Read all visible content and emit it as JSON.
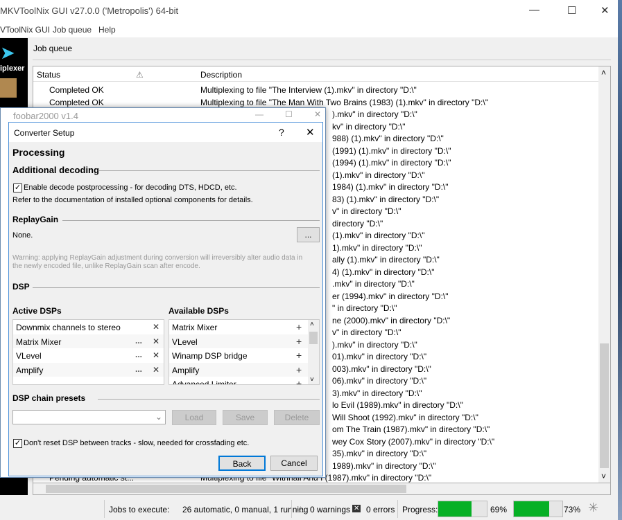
{
  "mkv": {
    "title": "MKVToolNix GUI v27.0.0 ('Metropolis') 64-bit",
    "menu": [
      "VToolNix GUI",
      "Job queue",
      "Help"
    ],
    "sidebar_label": "iplexer",
    "page_title": "Job queue",
    "columns": [
      "Status",
      "Description"
    ],
    "rows": [
      {
        "status": "Completed OK",
        "desc": "Multiplexing to file \"The Interview (1).mkv\" in directory \"D:\\\"",
        "frag": ""
      },
      {
        "status": "Completed OK",
        "desc": "Multiplexing to file \"The Man With Two Brains (1983) (1).mkv\" in directory \"D:\\\"",
        "frag": ""
      },
      {
        "status": "",
        "desc": "",
        "frag": ").mkv\" in directory \"D:\\\""
      },
      {
        "status": "",
        "desc": "",
        "frag": "kv\" in directory \"D:\\\""
      },
      {
        "status": "",
        "desc": "",
        "frag": "988) (1).mkv\" in directory \"D:\\\""
      },
      {
        "status": "",
        "desc": "",
        "frag": "(1991) (1).mkv\" in directory \"D:\\\""
      },
      {
        "status": "",
        "desc": "",
        "frag": "(1994) (1).mkv\" in directory \"D:\\\""
      },
      {
        "status": "",
        "desc": "",
        "frag": "(1).mkv\" in directory \"D:\\\""
      },
      {
        "status": "",
        "desc": "",
        "frag": "1984) (1).mkv\" in directory \"D:\\\""
      },
      {
        "status": "",
        "desc": "",
        "frag": "83) (1).mkv\" in directory \"D:\\\""
      },
      {
        "status": "",
        "desc": "",
        "frag": "v\" in directory \"D:\\\""
      },
      {
        "status": "",
        "desc": "",
        "frag": "directory \"D:\\\""
      },
      {
        "status": "",
        "desc": "",
        "frag": "(1).mkv\" in directory \"D:\\\""
      },
      {
        "status": "",
        "desc": "",
        "frag": "1).mkv\" in directory \"D:\\\""
      },
      {
        "status": "",
        "desc": "",
        "frag": "ally (1).mkv\" in directory \"D:\\\""
      },
      {
        "status": "",
        "desc": "",
        "frag": "4) (1).mkv\" in directory \"D:\\\""
      },
      {
        "status": "",
        "desc": "",
        "frag": ".mkv\" in directory \"D:\\\""
      },
      {
        "status": "",
        "desc": "",
        "frag": "er (1994).mkv\" in directory \"D:\\\""
      },
      {
        "status": "",
        "desc": "",
        "frag": "\" in directory \"D:\\\""
      },
      {
        "status": "",
        "desc": "",
        "frag": "ne (2000).mkv\" in directory \"D:\\\""
      },
      {
        "status": "",
        "desc": "",
        "frag": "v\" in directory \"D:\\\""
      },
      {
        "status": "",
        "desc": "",
        "frag": ").mkv\" in directory \"D:\\\""
      },
      {
        "status": "",
        "desc": "",
        "frag": "01).mkv\" in directory \"D:\\\""
      },
      {
        "status": "",
        "desc": "",
        "frag": "003).mkv\" in directory \"D:\\\""
      },
      {
        "status": "",
        "desc": "",
        "frag": "06).mkv\" in directory \"D:\\\""
      },
      {
        "status": "",
        "desc": "",
        "frag": "3).mkv\" in directory \"D:\\\""
      },
      {
        "status": "",
        "desc": "",
        "frag": "lo Evil (1989).mkv\" in directory \"D:\\\""
      },
      {
        "status": "",
        "desc": "",
        "frag": "Will Shoot (1992).mkv\" in directory \"D:\\\""
      },
      {
        "status": "",
        "desc": "",
        "frag": "om The Train (1987).mkv\" in directory \"D:\\\""
      },
      {
        "status": "",
        "desc": "",
        "frag": "wey Cox Story (2007).mkv\" in directory \"D:\\\""
      },
      {
        "status": "",
        "desc": "",
        "frag": "35).mkv\" in directory \"D:\\\""
      },
      {
        "status": "",
        "desc": "",
        "frag": "1989).mkv\" in directory \"D:\\\""
      },
      {
        "status": "Pending automatic st...",
        "desc": "Multiplexing to file \"Withnail And I (1987).mkv\" in directory \"D:\\\"",
        "frag": ""
      }
    ],
    "status": {
      "jobs_label": "Jobs to execute:",
      "jobs": "26 automatic, 0 manual, 1 running",
      "warnings": "0 warnings",
      "errors": "0 errors",
      "progress_label": "Progress:",
      "progress1": 69,
      "progress1_text": "69%",
      "progress2": 73,
      "progress2_text": "73%"
    }
  },
  "foobar": {
    "title": "foobar2000 v1.4",
    "dialog": {
      "title": "Converter Setup",
      "help": "?",
      "close": "✕",
      "heading": "Processing",
      "additional_decoding": "Additional decoding",
      "decode_check": "Enable decode postprocessing - for decoding DTS, HDCD, etc.",
      "decode_checked": true,
      "decode_note": "Refer to the documentation of installed optional components for details.",
      "replaygain": "ReplayGain",
      "replaygain_value": "None.",
      "more": "...",
      "warning1": "Warning: applying ReplayGain adjustment during conversion will irreversibly alter audio data in",
      "warning2": "the newly encoded file, unlike ReplayGain scan after encode.",
      "dsp": "DSP",
      "active_label": "Active DSPs",
      "available_label": "Available DSPs",
      "active": [
        {
          "name": "Downmix channels to stereo",
          "cfg": ""
        },
        {
          "name": "Matrix Mixer",
          "cfg": "..."
        },
        {
          "name": "VLevel",
          "cfg": "..."
        },
        {
          "name": "Amplify",
          "cfg": "..."
        }
      ],
      "available": [
        "Matrix Mixer",
        "VLevel",
        "Winamp DSP bridge",
        "Amplify",
        "Advanced Limiter"
      ],
      "presets": "DSP chain presets",
      "load": "Load",
      "save": "Save",
      "delete": "Delete",
      "reset_check": "Don't reset DSP between tracks - slow, needed for crossfading etc.",
      "reset_checked": true,
      "back": "Back",
      "cancel": "Cancel"
    }
  }
}
